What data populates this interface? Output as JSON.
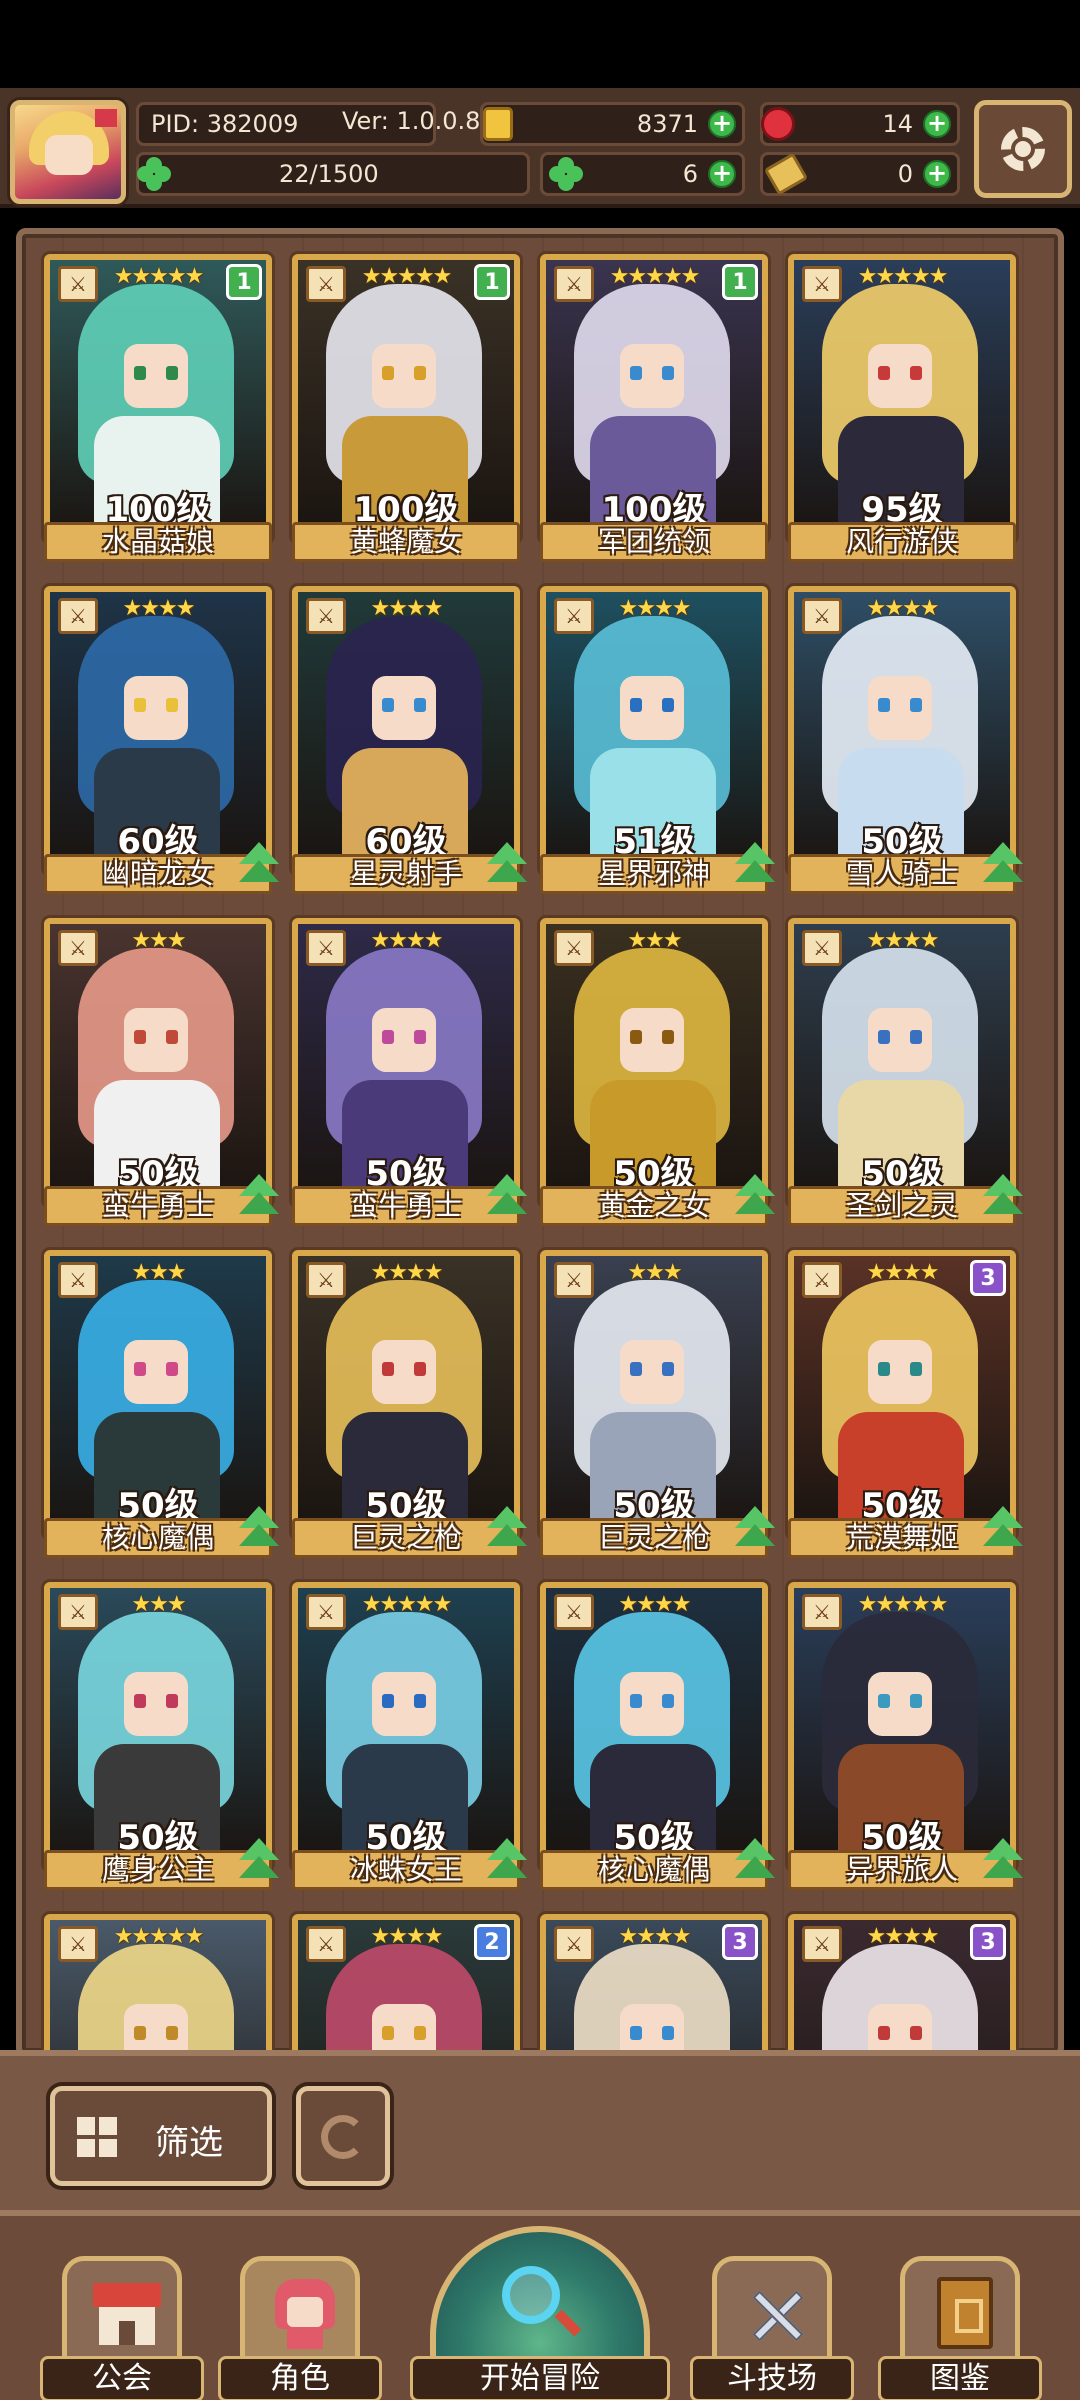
{
  "player": {
    "pid": "PID: 382009",
    "version": "Ver: 1.0.0.8",
    "stamina": "22/1500"
  },
  "currencies": {
    "gold": "8371",
    "gems": "14",
    "clover": "6",
    "keys": "0"
  },
  "heroes": [
    {
      "name": "水晶菇娘",
      "level": "100级",
      "stars": "★★★★★",
      "badge": "1",
      "badge_color": "green",
      "hair": "#5fd0b8",
      "body": "#e8f3f0",
      "bg": "#2f5a5a",
      "eye": "#2d8a4a",
      "upgrade": false
    },
    {
      "name": "黄蜂魔女",
      "level": "100级",
      "stars": "★★★★★",
      "badge": "1",
      "badge_color": "green",
      "hair": "#e8e8f0",
      "body": "#c89a3a",
      "bg": "#3a3226",
      "eye": "#d8a02a",
      "upgrade": false
    },
    {
      "name": "军团统领",
      "level": "100级",
      "stars": "★★★★★",
      "badge": "1",
      "badge_color": "green",
      "hair": "#e2ddf0",
      "body": "#6a5a9a",
      "bg": "#3a3450",
      "eye": "#3a8ad0",
      "upgrade": false
    },
    {
      "name": "风行游侠",
      "level": "95级",
      "stars": "★★★★★",
      "badge": "",
      "badge_color": "",
      "hair": "#f3cf6a",
      "body": "#2c2a3a",
      "bg": "#2a3e5a",
      "eye": "#c83a3a",
      "upgrade": false
    },
    {
      "name": "幽暗龙女",
      "level": "60级",
      "stars": "★★★★",
      "badge": "",
      "badge_color": "",
      "hair": "#2e6aa8",
      "body": "#2a3a48",
      "bg": "#1e3448",
      "eye": "#e8c03a",
      "upgrade": true
    },
    {
      "name": "星灵射手",
      "level": "60级",
      "stars": "★★★★",
      "badge": "",
      "badge_color": "",
      "hair": "#2a2450",
      "body": "#d8a85a",
      "bg": "#203a3a",
      "eye": "#3a8ad0",
      "upgrade": true
    },
    {
      "name": "星界邪神",
      "level": "51级",
      "stars": "★★★★",
      "badge": "",
      "badge_color": "",
      "hair": "#5ac0d8",
      "body": "#9ae0e8",
      "bg": "#1e5060",
      "eye": "#2a70c0",
      "upgrade": true
    },
    {
      "name": "雪人骑士",
      "level": "50级",
      "stars": "★★★★",
      "badge": "",
      "badge_color": "",
      "hair": "#e8f0f8",
      "body": "#c8dcef",
      "bg": "#2e4e66",
      "eye": "#3a8ad0",
      "upgrade": true
    },
    {
      "name": "蛮牛勇士",
      "level": "50级",
      "stars": "★★★",
      "badge": "",
      "badge_color": "",
      "hair": "#e89a8a",
      "body": "#f0f0f0",
      "bg": "#4a3430",
      "eye": "#c04a3a",
      "upgrade": true
    },
    {
      "name": "蛮牛勇士",
      "level": "50级",
      "stars": "★★★★",
      "badge": "",
      "badge_color": "",
      "hair": "#8a7ac8",
      "body": "#4a3a7a",
      "bg": "#2e2a48",
      "eye": "#c04a9a",
      "upgrade": true
    },
    {
      "name": "黄金之女",
      "level": "50级",
      "stars": "★★★",
      "badge": "",
      "badge_color": "",
      "hair": "#e0b840",
      "body": "#c89a2a",
      "bg": "#3a3020",
      "eye": "#8a5a10",
      "upgrade": true
    },
    {
      "name": "圣剑之灵",
      "level": "50级",
      "stars": "★★★★",
      "badge": "",
      "badge_color": "",
      "hair": "#d8e4f0",
      "body": "#e8d8a8",
      "bg": "#2e3e4e",
      "eye": "#3a70c0",
      "upgrade": true
    },
    {
      "name": "核心魔偶",
      "level": "50级",
      "stars": "★★★",
      "badge": "",
      "badge_color": "",
      "hair": "#3ab0e8",
      "body": "#2a3a3a",
      "bg": "#1e3a4a",
      "eye": "#d04a8a",
      "upgrade": true
    },
    {
      "name": "巨灵之枪",
      "level": "50级",
      "stars": "★★★★",
      "badge": "",
      "badge_color": "",
      "hair": "#e8c05a",
      "body": "#2a2a3a",
      "bg": "#3a3226",
      "eye": "#c03a3a",
      "upgrade": true
    },
    {
      "name": "巨灵之枪",
      "level": "50级",
      "stars": "★★★",
      "badge": "",
      "badge_color": "",
      "hair": "#e8ecf4",
      "body": "#9aa4b8",
      "bg": "#3a4050",
      "eye": "#3a70c0",
      "upgrade": true
    },
    {
      "name": "荒漠舞姬",
      "level": "50级",
      "stars": "★★★★",
      "badge": "3",
      "badge_color": "purple",
      "hair": "#f0c860",
      "body": "#c8402a",
      "bg": "#5a3226",
      "eye": "#2a8a8a",
      "upgrade": true
    },
    {
      "name": "鹰身公主",
      "level": "50级",
      "stars": "★★★",
      "badge": "",
      "badge_color": "",
      "hair": "#7ad8e0",
      "body": "#3a3a3a",
      "bg": "#2a4a5a",
      "eye": "#c03a5a",
      "upgrade": true
    },
    {
      "name": "冰蛛女王",
      "level": "50级",
      "stars": "★★★★★",
      "badge": "",
      "badge_color": "",
      "hair": "#7ad0e8",
      "body": "#2a3a4a",
      "bg": "#1e4050",
      "eye": "#2a6ac0",
      "upgrade": true
    },
    {
      "name": "核心魔偶",
      "level": "50级",
      "stars": "★★★★",
      "badge": "",
      "badge_color": "",
      "hair": "#5ac8e8",
      "body": "#2a2a3a",
      "bg": "#1e3040",
      "eye": "#3a8ad0",
      "upgrade": true
    },
    {
      "name": "异界旅人",
      "level": "50级",
      "stars": "★★★★★",
      "badge": "",
      "badge_color": "",
      "hair": "#2a2a3a",
      "body": "#8a4a2a",
      "bg": "#2a3e5a",
      "eye": "#3a9ac0",
      "upgrade": true
    },
    {
      "name": "",
      "level": "",
      "stars": "★★★★★",
      "badge": "",
      "badge_color": "",
      "hair": "#f0d888",
      "body": "#e8d8b0",
      "bg": "#4a5a6a",
      "eye": "#c08a2a",
      "upgrade": false
    },
    {
      "name": "",
      "level": "",
      "stars": "★★★★",
      "badge": "2",
      "badge_color": "blue",
      "hair": "#c04a6a",
      "body": "#4a8a5a",
      "bg": "#2a3a3a",
      "eye": "#d8a02a",
      "upgrade": false
    },
    {
      "name": "",
      "level": "",
      "stars": "★★★★",
      "badge": "3",
      "badge_color": "purple",
      "hair": "#f0e0c8",
      "body": "#d8c8a8",
      "bg": "#3a4a5a",
      "eye": "#3a8ad0",
      "upgrade": false
    },
    {
      "name": "",
      "level": "",
      "stars": "★★★★",
      "badge": "3",
      "badge_color": "purple",
      "hair": "#f0e8ec",
      "body": "#8a3a3a",
      "bg": "#3a2a30",
      "eye": "#c03a3a",
      "upgrade": false
    }
  ],
  "filter": {
    "label": "筛选"
  },
  "nav": {
    "guild": "公会",
    "heroes": "角色",
    "adventure": "开始冒险",
    "arena": "斗技场",
    "codex": "图鉴"
  }
}
